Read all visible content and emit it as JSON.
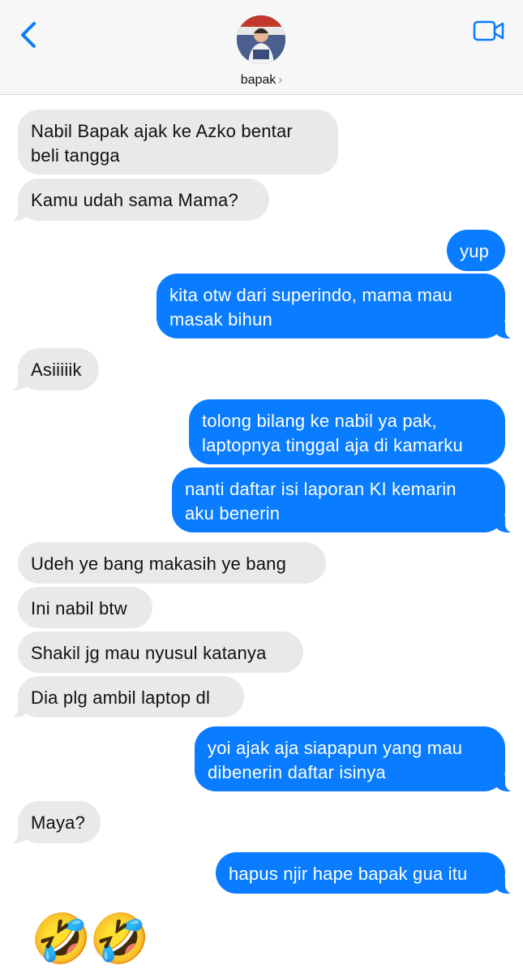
{
  "header": {
    "contact_name": "bapak",
    "chevron": "›",
    "back_icon": "chevron-left-icon",
    "video_icon": "video-camera-icon",
    "accent": "#0a7cff"
  },
  "colors": {
    "incoming_bubble": "#e9e9eb",
    "outgoing_bubble": "#0a7cff"
  },
  "messages": [
    {
      "dir": "in",
      "text": "Nabil Bapak ajak ke Azko bentar\nbeli tangga"
    },
    {
      "dir": "in",
      "text": "Kamu udah sama Mama?"
    },
    {
      "dir": "out",
      "text": "yup"
    },
    {
      "dir": "out",
      "text": "kita otw dari superindo, mama mau\nmasak bihun"
    },
    {
      "dir": "in",
      "text": "Asiiiiik"
    },
    {
      "dir": "out",
      "text": "tolong bilang ke nabil ya pak,\nlaptopnya tinggal aja di kamarku"
    },
    {
      "dir": "out",
      "text": "nanti daftar isi laporan KI kemarin\naku benerin"
    },
    {
      "dir": "in",
      "text": "Udeh ye bang makasih ye bang"
    },
    {
      "dir": "in",
      "text": "Ini nabil btw"
    },
    {
      "dir": "in",
      "text": "Shakil jg mau nyusul katanya"
    },
    {
      "dir": "in",
      "text": "Dia plg ambil laptop dl"
    },
    {
      "dir": "out",
      "text": "yoi ajak aja siapapun yang mau\ndibenerin daftar isinya"
    },
    {
      "dir": "in",
      "text": "Maya?"
    },
    {
      "dir": "out",
      "text": "hapus njir hape bapak gua itu"
    }
  ],
  "reaction_emojis": [
    "🤣",
    "🤣"
  ]
}
